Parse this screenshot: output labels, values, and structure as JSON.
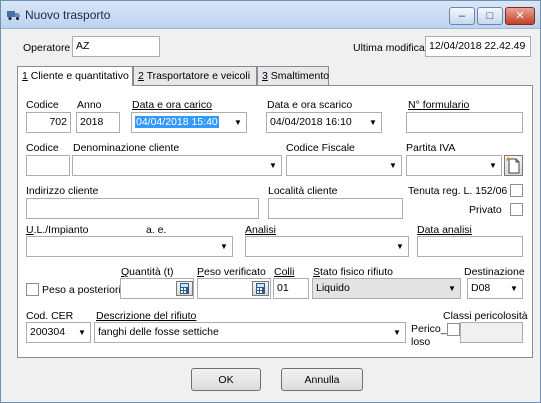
{
  "window": {
    "title": "Nuovo trasporto",
    "min_glyph": "–",
    "max_glyph": "□",
    "close_glyph": "✕"
  },
  "header": {
    "operatore_label": "Operatore",
    "operatore_value": "AZ",
    "ultima_modifica_label": "Ultima modifica",
    "ultima_modifica_value": "12/04/2018 22.42.49"
  },
  "tabs": [
    {
      "key": "1",
      "rest": " Cliente e quantitativo",
      "active": true
    },
    {
      "key": "2",
      "rest": " Trasportatore e veicoli",
      "active": false
    },
    {
      "key": "3",
      "rest": " Smaltimento",
      "active": false
    }
  ],
  "form": {
    "codice_label": "Codice",
    "codice_value": "702",
    "anno_label": "Anno",
    "anno_value": "2018",
    "data_carico_label": "Data e ora carico",
    "data_carico_value": "04/04/2018 15:40",
    "data_scarico_label": "Data e ora scarico",
    "data_scarico_value": "04/04/2018 16:10",
    "formulario_label": "N° formulario",
    "formulario_value": "",
    "cliente_codice_label": "Codice",
    "denominazione_label": "Denominazione cliente",
    "codice_fiscale_label": "Codice Fiscale",
    "partita_iva_label": "Partita IVA",
    "indirizzo_label": "Indirizzo cliente",
    "localita_label": "Località cliente",
    "tenuta_label": "Tenuta reg. L. 152/06",
    "privato_label": "Privato",
    "ul_impianto_label": "U.L./Impianto",
    "ae_label": "a. e.",
    "analisi_label": "Analisi",
    "data_analisi_label": "Data analisi",
    "peso_posteriori_label": "Peso a posteriori",
    "quantita_label": "Quantità (t)",
    "peso_verificato_label": "Peso verificato",
    "colli_label": "Colli",
    "colli_value": "01",
    "stato_fisico_label": "Stato fisico rifiuto",
    "stato_fisico_value": "Liquido",
    "destinazione_label": "Destinazione",
    "destinazione_value": "D08",
    "cer_label": "Cod. CER",
    "cer_value": "200304",
    "descrizione_label": "Descrizione del rifiuto",
    "descrizione_value": "fanghi delle fosse settiche",
    "pericoloso_label_1": "Perico_",
    "pericoloso_label_2": "loso",
    "classi_label": "Classi pericolosità"
  },
  "buttons": {
    "ok": "OK",
    "annulla": "Annulla"
  },
  "colors": {
    "selection": "#3399ff",
    "title_gradient_top": "#d9e7f7",
    "close_red": "#c2412b"
  }
}
